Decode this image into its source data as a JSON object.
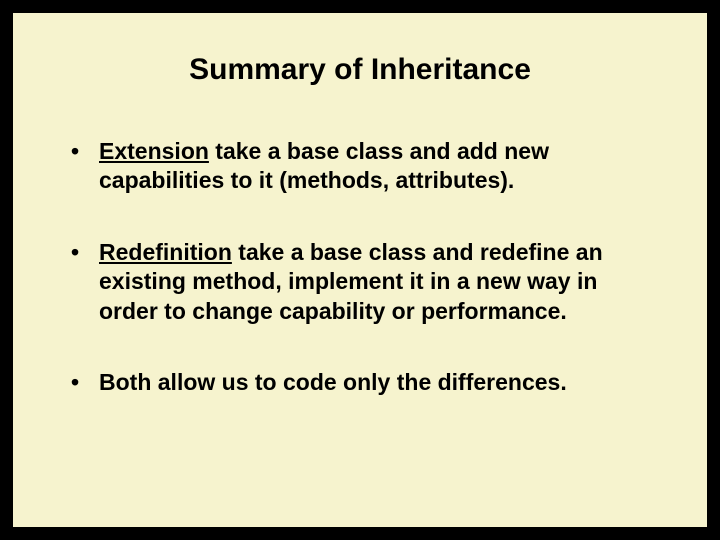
{
  "title": "Summary of Inheritance",
  "bullets": [
    {
      "keyword": "Extension",
      "rest": " take a base class and add new capabilities to it (methods, attributes)."
    },
    {
      "keyword": "Redefinition",
      "rest": " take a base class and redefine an existing method, implement it in a new way in order to change capability or performance."
    },
    {
      "keyword": "",
      "rest": "Both allow us to code only the differences."
    }
  ]
}
